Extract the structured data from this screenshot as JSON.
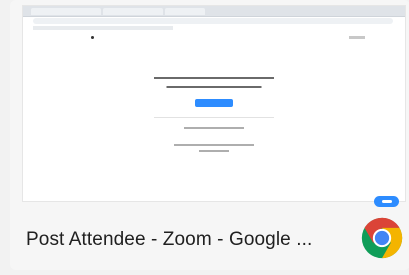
{
  "window_preview": {
    "caption": "Post Attendee - Zoom - Google ...",
    "app_icon": "google-chrome-icon",
    "badge_icon": "zoom-badge-icon"
  },
  "colors": {
    "zoom_blue": "#2d8cff",
    "chrome_red": "#DB4437",
    "chrome_yellow": "#F4B400",
    "chrome_green": "#0F9D58",
    "chrome_blue": "#4285F4"
  }
}
